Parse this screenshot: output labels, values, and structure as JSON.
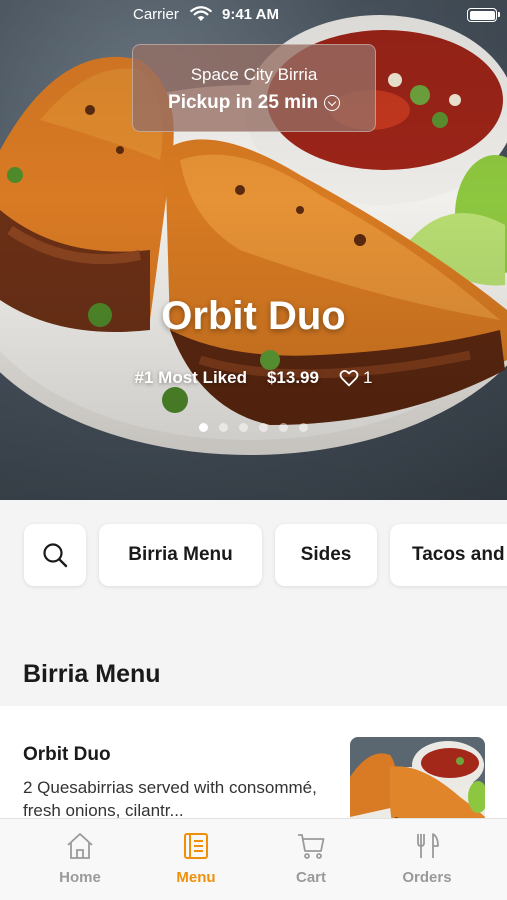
{
  "status_bar": {
    "carrier": "Carrier",
    "time": "9:41 AM"
  },
  "pickup": {
    "store": "Space City Birria",
    "eta": "Pickup in 25 min"
  },
  "hero": {
    "title": "Orbit Duo",
    "tag": "#1 Most Liked",
    "price": "$13.99",
    "likes": "1",
    "carousel_pages": 6,
    "carousel_active": 1
  },
  "categories": [
    {
      "label": "Birria Menu"
    },
    {
      "label": "Sides"
    },
    {
      "label": "Tacos and"
    }
  ],
  "section": {
    "title": "Birria Menu"
  },
  "item": {
    "name": "Orbit Duo",
    "description": "2 Quesabirrias served with consommé, fresh onions, cilantr..."
  },
  "tabs": [
    {
      "label": "Home",
      "icon": "home-icon"
    },
    {
      "label": "Menu",
      "icon": "menu-book-icon",
      "active": true
    },
    {
      "label": "Cart",
      "icon": "cart-icon"
    },
    {
      "label": "Orders",
      "icon": "fork-knife-icon"
    }
  ],
  "colors": {
    "accent": "#f0900a",
    "inactive": "#9a9a9a"
  }
}
